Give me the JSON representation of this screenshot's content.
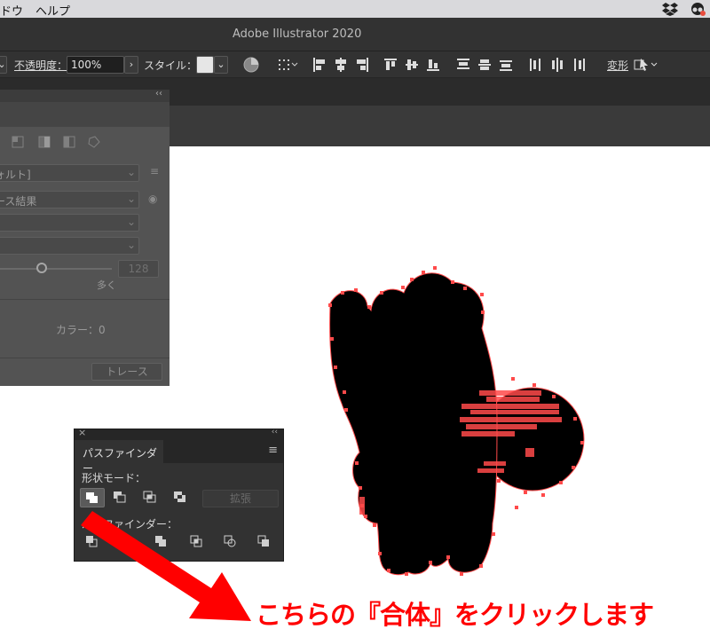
{
  "menubar": {
    "items": [
      "ドウ",
      "ヘルプ"
    ],
    "status_icons": [
      "dropbox-icon",
      "creative-cloud-icon"
    ]
  },
  "app": {
    "title": "Adobe Illustrator 2020"
  },
  "controlbar": {
    "opacity_label": "不透明度：",
    "opacity_value": "100%",
    "style_label": "スタイル：",
    "transform_label": "変形"
  },
  "trace_panel": {
    "preset_value": "ォルト]",
    "view_value": "ース結果",
    "slider_value": "128",
    "slider_label": "多く",
    "colors_text": "カラー：0",
    "trace_button": "トレース"
  },
  "pathfinder": {
    "tab_label": "パスファインダー",
    "shape_modes_label": "形状モード：",
    "expand_button": "拡張",
    "pathfinders_label": "パスファインダー：",
    "shape_mode_icons": [
      "unite-icon",
      "minus-front-icon",
      "intersect-icon",
      "exclude-icon"
    ],
    "pathfinder_icons": [
      "divide-icon",
      "trim-icon",
      "merge-icon",
      "crop-icon",
      "outline-icon",
      "minus-back-icon"
    ]
  },
  "annotation": {
    "caption": "こちらの『合体』をクリックします",
    "color": "#ff0000"
  },
  "colors": {
    "selection": "#ff4a4a",
    "ui_dark": "#323232",
    "panel_gray": "#535353"
  }
}
